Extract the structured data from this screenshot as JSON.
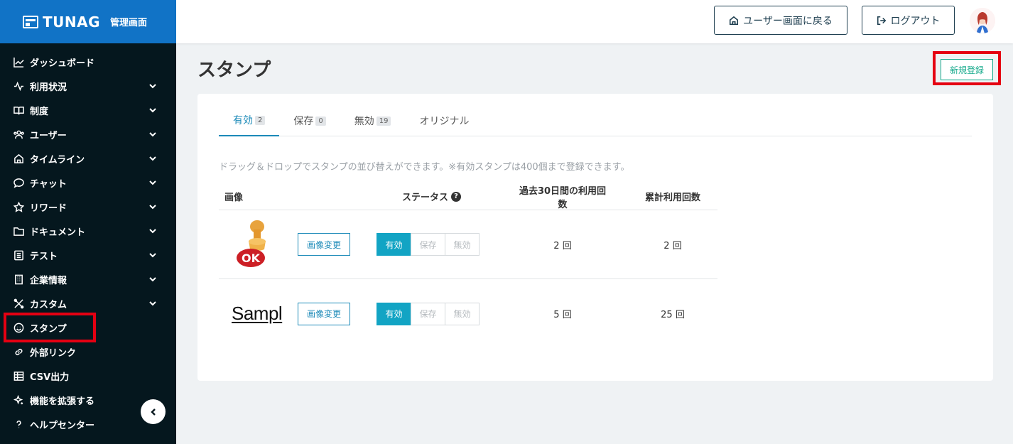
{
  "brand": {
    "name": "TUNAG",
    "subtitle": "管理画面"
  },
  "sidebar": {
    "items": [
      {
        "label": "ダッシュボード",
        "icon": "chart-line-icon",
        "expandable": false
      },
      {
        "label": "利用状況",
        "icon": "pulse-icon",
        "expandable": true
      },
      {
        "label": "制度",
        "icon": "book-icon",
        "expandable": true
      },
      {
        "label": "ユーザー",
        "icon": "users-icon",
        "expandable": true
      },
      {
        "label": "タイムライン",
        "icon": "home-icon",
        "expandable": true
      },
      {
        "label": "チャット",
        "icon": "chat-icon",
        "expandable": true
      },
      {
        "label": "リワード",
        "icon": "star-icon",
        "expandable": true
      },
      {
        "label": "ドキュメント",
        "icon": "folder-icon",
        "expandable": true
      },
      {
        "label": "テスト",
        "icon": "checklist-icon",
        "expandable": true
      },
      {
        "label": "企業情報",
        "icon": "building-icon",
        "expandable": true
      },
      {
        "label": "カスタム",
        "icon": "tools-icon",
        "expandable": true
      },
      {
        "label": "スタンプ",
        "icon": "smile-icon",
        "expandable": false,
        "highlighted": true
      },
      {
        "label": "外部リンク",
        "icon": "link-icon",
        "expandable": false
      },
      {
        "label": "CSV出力",
        "icon": "table-icon",
        "expandable": false
      },
      {
        "label": "機能を拡張する",
        "icon": "sparkle-icon",
        "expandable": false
      },
      {
        "label": "ヘルプセンター",
        "icon": "help-icon",
        "expandable": false
      }
    ]
  },
  "header": {
    "back_label": "ユーザー画面に戻る",
    "logout_label": "ログアウト"
  },
  "page": {
    "title": "スタンプ",
    "new_button": "新規登録",
    "hint": "ドラッグ＆ドロップでスタンプの並び替えができます。※有効スタンプは400個まで登録できます。"
  },
  "tabs": [
    {
      "label": "有効",
      "count": "2",
      "active": true
    },
    {
      "label": "保存",
      "count": "0"
    },
    {
      "label": "無効",
      "count": "19"
    },
    {
      "label": "オリジナル",
      "count": ""
    }
  ],
  "table": {
    "headers": {
      "image": "画像",
      "status": "ステータス",
      "recent": "過去30日間の利用回数",
      "total": "累計利用回数"
    },
    "change_label": "画像変更",
    "status_options": [
      "有効",
      "保存",
      "無効"
    ],
    "rows": [
      {
        "image": "ok-stamp",
        "image_text": "OK",
        "status": "有効",
        "recent": "2 回",
        "total": "2 回"
      },
      {
        "image": "sample-text",
        "image_text": "Sampl",
        "status": "有効",
        "recent": "5 回",
        "total": "25 回"
      }
    ]
  },
  "colors": {
    "brand_blue": "#1173c6",
    "sidebar_bg": "#05171e",
    "accent": "#12a4c4",
    "highlight_red": "#e50012",
    "new_green": "#14a98b"
  }
}
